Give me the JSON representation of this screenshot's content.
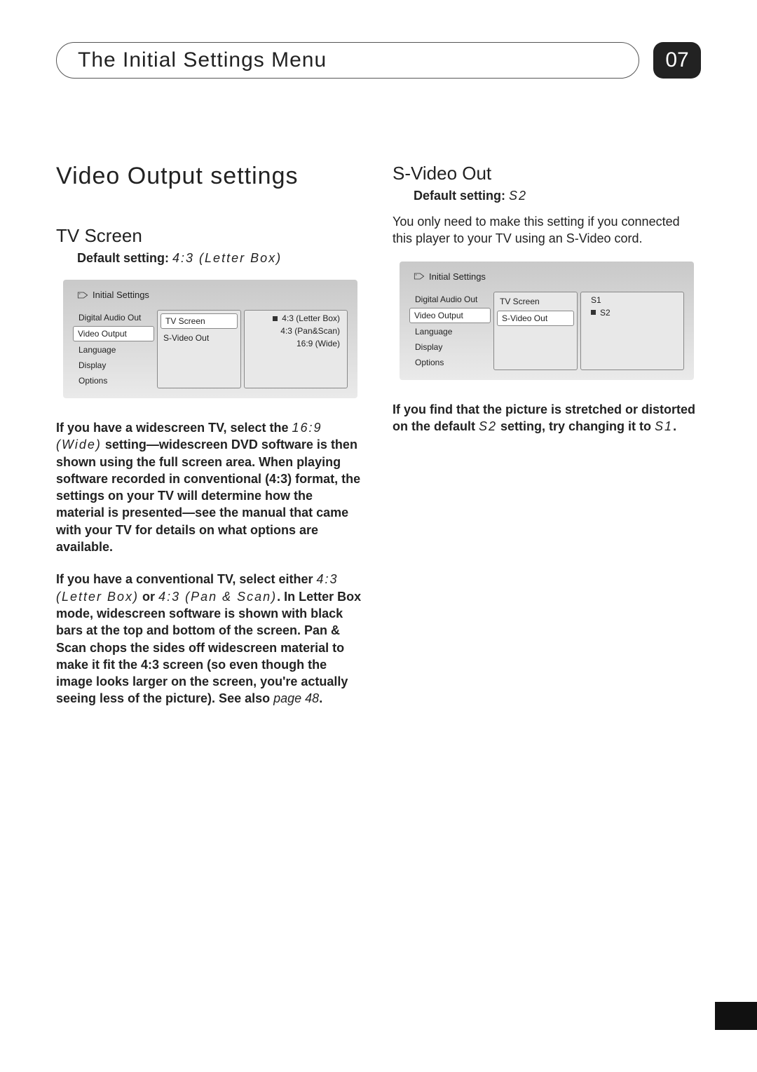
{
  "header": {
    "title": "The Initial Settings Menu",
    "chapter": "07"
  },
  "leftCol": {
    "h1": "Video Output settings",
    "h2": "TV Screen",
    "defaultLabel": "Default setting:",
    "defaultValue": "4:3 (Letter Box)",
    "menu": {
      "title": "Initial Settings",
      "col1": [
        "Digital Audio Out",
        "Video Output",
        "Language",
        "Display",
        "Options"
      ],
      "col1_selectedIndex": 1,
      "col2": [
        "TV Screen",
        "S-Video Out"
      ],
      "col2_selectedIndex": 0,
      "col3": [
        {
          "label": "4:3 (Letter Box)",
          "marker": true
        },
        {
          "label": "4:3 (Pan&Scan)",
          "marker": false
        },
        {
          "label": "16:9 (Wide)",
          "marker": false
        }
      ]
    },
    "para1_a": "If you have a widescreen TV, select the ",
    "para1_b": "16:9 (Wide)",
    "para1_c": " setting—widescreen DVD software is then shown using the full screen area. When playing software recorded in conventional (4:3) format, the settings on your TV will determine how the material is presented—see the manual that came with your TV for details on what options are available.",
    "para2_a": "If you have a conventional TV, select either ",
    "para2_b": "4:3 (Letter Box)",
    "para2_c": " or ",
    "para2_d": "4:3 (Pan & Scan)",
    "para2_e": ". In Letter Box mode, widescreen software is shown with black bars at the top and bottom of the screen. Pan & Scan chops the sides off widescreen material to make it fit the 4:3 screen (so even though the image looks larger on the screen, you're actually seeing less of the picture). See also ",
    "para2_f": "page 48",
    "para2_g": "."
  },
  "rightCol": {
    "h2": "S-Video Out",
    "defaultLabel": "Default setting:",
    "defaultValue": "S2",
    "plain": "You only need to make this setting if you connected this player to your TV using an S-Video cord.",
    "menu": {
      "title": "Initial Settings",
      "col1": [
        "Digital Audio Out",
        "Video Output",
        "Language",
        "Display",
        "Options"
      ],
      "col1_selectedIndex": 1,
      "col2": [
        "TV Screen",
        "S-Video Out"
      ],
      "col2_selectedIndex": 1,
      "col3": [
        {
          "label": "S1",
          "marker": false
        },
        {
          "label": "S2",
          "marker": true
        }
      ]
    },
    "para1_a": "If you find that the picture is stretched or distorted on the default ",
    "para1_b": "S2",
    "para1_c": " setting, try changing it to ",
    "para1_d": "S1",
    "para1_e": "."
  }
}
